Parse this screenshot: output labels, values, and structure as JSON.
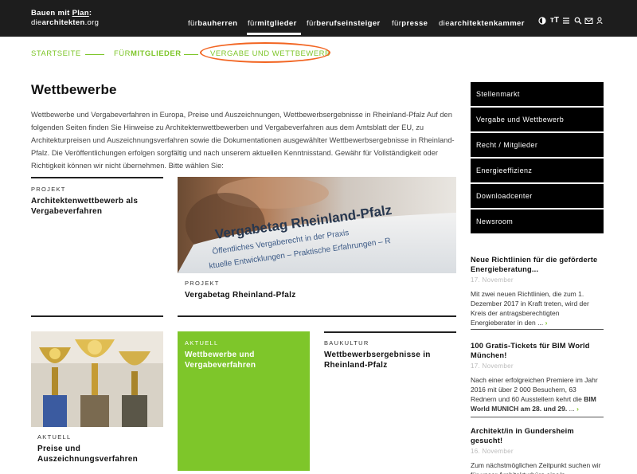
{
  "header": {
    "logo_line1_a": "Bauen mit ",
    "logo_line1_plan": "Plan",
    "logo_line1_b": ":",
    "logo_line2_a": "die",
    "logo_line2_b": "architekten",
    "logo_line2_c": ".org",
    "nav": [
      {
        "prefix": "für",
        "word": "bauherren"
      },
      {
        "prefix": "für",
        "word": "mitglieder"
      },
      {
        "prefix": "für",
        "word": "berufseinsteiger"
      },
      {
        "prefix": "für",
        "word": "presse"
      },
      {
        "prefix": "die",
        "word": "architektenkammer"
      }
    ],
    "icons": [
      "contrast-icon",
      "font-size-icon",
      "menu-icon",
      "search-icon",
      "mail-icon",
      "user-icon"
    ]
  },
  "breadcrumb": {
    "home": "STARTSEITE",
    "level2_prefix": "FÜR",
    "level2_word": "MITGLIEDER",
    "current": "VERGABE UND WETTBEWERB"
  },
  "main": {
    "title": "Wettbewerbe",
    "intro": "Wettbewerbe und Vergabeverfahren in Europa, Preise und Auszeichnungen, Wettbewerbsergebnisse in Rheinland-Pfalz Auf den folgenden Seiten finden Sie Hinweise zu Architektenwettbewerben und Vergabeverfahren aus dem Amtsblatt der EU, zu Architekturpreisen und Auszeichnungsverfahren sowie die Dokumentationen ausgewählter Wettbewerbsergebnisse in Rheinland-Pfalz. Die Veröffentlichungen erfolgen sorgfältig und nach unserem aktuellen Kenntnisstand. Gewähr für Vollständigkeit oder Richtigkeit können wir nicht übernehmen. Bitte wählen Sie:",
    "cards": [
      {
        "label": "PROJEKT",
        "title": "Architektenwettbewerb als Vergabeverfahren"
      },
      {
        "label": "PROJEKT",
        "title": "Vergabetag Rheinland-Pfalz",
        "image_text_1": "Vergabetag Rheinland-Pfalz",
        "image_text_2": "Öffentliches Vergaberecht in der Praxis",
        "image_text_3": "ktuelle Entwicklungen – Praktische Erfahrungen – R"
      },
      {
        "label": "AKTUELL",
        "title": "Preise und Auszeichnungsverfahren"
      },
      {
        "label": "AKTUELL",
        "title": "Wettbewerbe und Vergabeverfahren"
      },
      {
        "label": "BAUKULTUR",
        "title": "Wettbewerbsergebnisse in Rheinland-Pfalz"
      }
    ]
  },
  "sidebar": {
    "menu": [
      "Stellenmarkt",
      "Vergabe und Wettbewerb",
      "Recht / Mitglieder",
      "Energieeffizienz",
      "Downloadcenter",
      "Newsroom"
    ],
    "news": [
      {
        "title": "Neue Richtlinien für die geförderte Energieberatung...",
        "date": "17. November",
        "text": "Mit zwei neuen Richtlinien, die zum 1. Dezember 2017 in Kraft treten, wird der Kreis der antragsberechtigten Energieberater in den ..."
      },
      {
        "title": "100 Gratis-Tickets für BIM World München!",
        "date": "17. November",
        "text_a": "Nach einer erfolgreichen Premiere im Jahr 2016 mit über 2 000 Besuchern, 63 Rednern und 60 Ausstellern kehrt die ",
        "text_b": "BIM World MUNICH am 28. und 29.",
        "text_c": " ..."
      },
      {
        "title": "Architekt/in in Gundersheim gesucht!",
        "date": "16. November",
        "text": "Zum nächstmöglichen Zeitpunkt suchen wir für unser Architekturbüro eine/n"
      }
    ]
  },
  "colors": {
    "accent": "#7ec62a",
    "header_bg": "#1d1d1d",
    "highlight_circle": "#f26522"
  }
}
